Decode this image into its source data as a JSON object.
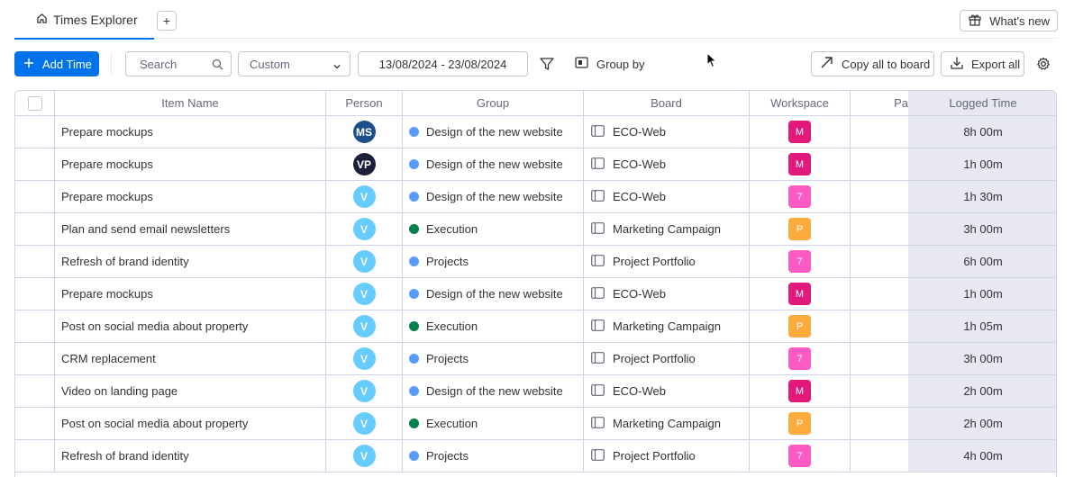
{
  "tabs": {
    "active_label": "Times Explorer",
    "add_label": "+",
    "whats_new_label": "What's new"
  },
  "toolbar": {
    "add_time_label": "Add Time",
    "search_placeholder": "Search",
    "period_select": "Custom",
    "date_range": "13/08/2024 - 23/08/2024",
    "group_by_label": "Group by",
    "copy_all_label": "Copy all to board",
    "export_all_label": "Export all"
  },
  "columns": {
    "item_name": "Item Name",
    "person": "Person",
    "group": "Group",
    "board": "Board",
    "workspace": "Workspace",
    "pa": "Pa",
    "logged_time": "Logged Time"
  },
  "colors": {
    "primary": "#0073ea",
    "dot_blue": "#579bfc",
    "dot_green": "#037f4c",
    "ws_magenta": "#e2187b",
    "ws_pink": "#ff5ac4",
    "ws_orange": "#fdab3d",
    "avatar_ms": "#1f4e8c",
    "avatar_vp": "#1c1f3b",
    "avatar_v": "#66ccff"
  },
  "rows": [
    {
      "item": "Prepare mockups",
      "person": "MS",
      "group": "Design of the new website",
      "group_color": "#579bfc",
      "board": "ECO-Web",
      "ws": "M",
      "ws_color": "#e2187b",
      "time": "8h 00m"
    },
    {
      "item": "Prepare mockups",
      "person": "VP",
      "group": "Design of the new website",
      "group_color": "#579bfc",
      "board": "ECO-Web",
      "ws": "M",
      "ws_color": "#e2187b",
      "time": "1h 00m"
    },
    {
      "item": "Prepare mockups",
      "person": "V",
      "group": "Design of the new website",
      "group_color": "#579bfc",
      "board": "ECO-Web",
      "ws": "7",
      "ws_color": "#ff5ac4",
      "time": "1h 30m"
    },
    {
      "item": "Plan and send email newsletters",
      "person": "V",
      "group": "Execution",
      "group_color": "#037f4c",
      "board": "Marketing Campaign",
      "ws": "P",
      "ws_color": "#fdab3d",
      "time": "3h 00m"
    },
    {
      "item": "Refresh of brand identity",
      "person": "V",
      "group": "Projects",
      "group_color": "#579bfc",
      "board": "Project Portfolio",
      "ws": "7",
      "ws_color": "#ff5ac4",
      "time": "6h 00m"
    },
    {
      "item": "Prepare mockups",
      "person": "V",
      "group": "Design of the new website",
      "group_color": "#579bfc",
      "board": "ECO-Web",
      "ws": "M",
      "ws_color": "#e2187b",
      "time": "1h 00m"
    },
    {
      "item": "Post on social media about property",
      "person": "V",
      "group": "Execution",
      "group_color": "#037f4c",
      "board": "Marketing Campaign",
      "ws": "P",
      "ws_color": "#fdab3d",
      "time": "1h 05m"
    },
    {
      "item": "CRM replacement",
      "person": "V",
      "group": "Projects",
      "group_color": "#579bfc",
      "board": "Project Portfolio",
      "ws": "7",
      "ws_color": "#ff5ac4",
      "time": "3h 00m"
    },
    {
      "item": "Video on landing page",
      "person": "V",
      "group": "Design of the new website",
      "group_color": "#579bfc",
      "board": "ECO-Web",
      "ws": "M",
      "ws_color": "#e2187b",
      "time": "2h 00m"
    },
    {
      "item": "Post on social media about property",
      "person": "V",
      "group": "Execution",
      "group_color": "#037f4c",
      "board": "Marketing Campaign",
      "ws": "P",
      "ws_color": "#fdab3d",
      "time": "2h 00m"
    },
    {
      "item": "Refresh of brand identity",
      "person": "V",
      "group": "Projects",
      "group_color": "#579bfc",
      "board": "Project Portfolio",
      "ws": "7",
      "ws_color": "#ff5ac4",
      "time": "4h 00m"
    }
  ]
}
